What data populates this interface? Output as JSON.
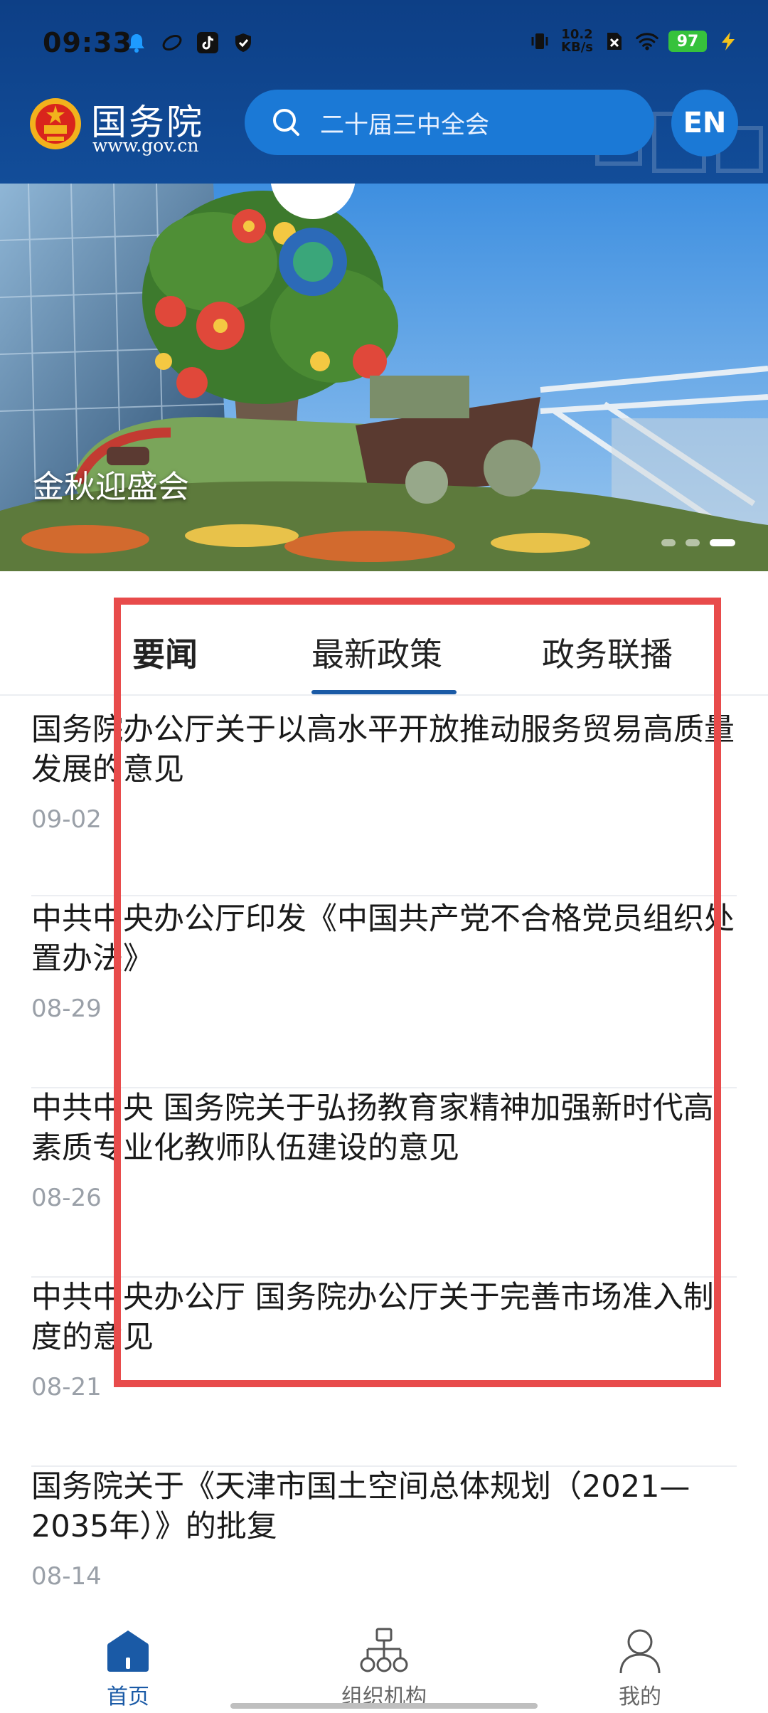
{
  "status_bar": {
    "time": "09:33",
    "net_speed_value": "10.2",
    "net_speed_unit": "KB/s",
    "battery": "97",
    "left_icons": [
      "bell-icon",
      "link-icon",
      "tiktok-icon",
      "shield-icon"
    ],
    "right_icons": [
      "vibrate-icon",
      "sim-off-icon",
      "wifi-icon",
      "charging-icon"
    ]
  },
  "header": {
    "site_name": "国务院",
    "site_url": "www.gov.cn",
    "search_placeholder": "二十届三中全会",
    "lang_button": "EN"
  },
  "banner": {
    "caption": "金秋迎盛会",
    "slides": 3,
    "active_slide": 3
  },
  "tabs": [
    {
      "label": "要闻",
      "active": false
    },
    {
      "label": "最新政策",
      "active": true
    },
    {
      "label": "政务联播",
      "active": false
    }
  ],
  "news": [
    {
      "title": "国务院办公厅关于以高水平开放推动服务贸易高质量发展的意见",
      "date": "09-02"
    },
    {
      "title": "中共中央办公厅印发《中国共产党不合格党员组织处置办法》",
      "date": "08-29"
    },
    {
      "title": "中共中央 国务院关于弘扬教育家精神加强新时代高素质专业化教师队伍建设的意见",
      "date": "08-26"
    },
    {
      "title": "中共中央办公厅 国务院办公厅关于完善市场准入制度的意见",
      "date": "08-21"
    },
    {
      "title": "国务院关于《天津市国土空间总体规划（2021—2035年）》的批复",
      "date": "08-14"
    }
  ],
  "bottom_nav": [
    {
      "label": "首页",
      "icon": "home-icon",
      "active": true
    },
    {
      "label": "组织机构",
      "icon": "org-chart-icon",
      "active": false
    },
    {
      "label": "我的",
      "icon": "user-icon",
      "active": false
    }
  ],
  "colors": {
    "header_bg": "#124d99",
    "search_bg": "#1b79d6",
    "accent": "#1a5aa6",
    "highlight_box": "#e84b4b",
    "date_text": "#9aa0a8"
  }
}
